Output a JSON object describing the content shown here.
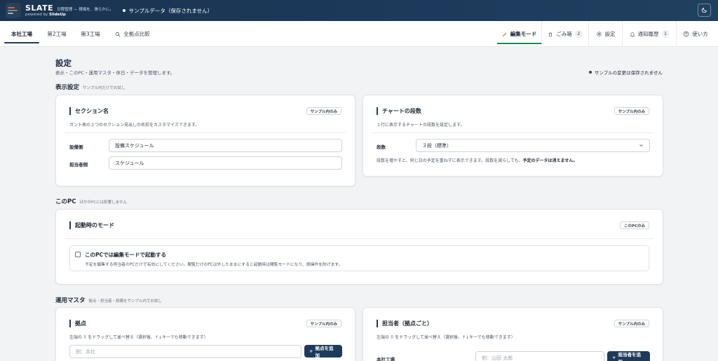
{
  "app": {
    "brand_name": "SLATE",
    "tagline": "日程管理 — 現場を、滑らかに。",
    "powered_prefix": "powered by ",
    "powered_by": "SlideUp",
    "sample_status": "サンプルデータ（保存されません）"
  },
  "nav": {
    "tabs": [
      {
        "label": "本社工場",
        "active": true
      },
      {
        "label": "第2工場"
      },
      {
        "label": "第3工場"
      },
      {
        "label": "全拠点比較",
        "icon": "search-icon"
      }
    ],
    "right": {
      "edit_mode": "編集モード",
      "trash": "ごみ箱",
      "trash_count": "2",
      "settings": "設定",
      "notifications": "通知履歴",
      "notifications_count": "1",
      "help": "使い方"
    }
  },
  "page": {
    "title": "設定",
    "subtitle": "表示・このPC・運用マスタ・休日・データを管理します。",
    "unsaved_note": "サンプルの変更は保存されません"
  },
  "sections": {
    "display": {
      "title": "表示設定",
      "note": "サンプル内だけでお試し"
    },
    "this_pc": {
      "title": "このPC",
      "note": "ほかのPCには影響しません"
    },
    "master": {
      "title": "運用マスタ",
      "note": "拠点・担当者・設備をサンプル内でお試し"
    }
  },
  "cards": {
    "section_name": {
      "title": "セクション名",
      "pill": "サンプル内のみ",
      "desc": "ガント表の２つのセクション見出しの名前をカスタマイズできます。",
      "equipment_label": "設備側",
      "equipment_value": "設備スケジュール",
      "person_label": "担当者側",
      "person_value": "スケジュール"
    },
    "chart_rows": {
      "title": "チャートの段数",
      "pill": "サンプル内のみ",
      "desc": "１行に表示するチャートの段数を設定します。",
      "rows_label": "段数",
      "rows_value": "３段（標準）",
      "note_main": "段数を増やすと、同じ日の予定を重ねずに表示できます。段数を減らしても、",
      "note_bold": "予定のデータは消えません。"
    },
    "startup_mode": {
      "title": "起動時のモード",
      "pill": "このPCのみ",
      "check_label": "このPCでは編集モードで起動する",
      "check_desc": "予定を編集する担当者のPCだけで有効にしてください。閲覧だけのPCは外したままにすると起動時は閲覧モードになり、誤操作を防げます。",
      "checked": false
    },
    "sites": {
      "title": "拠点",
      "pill": "サンプル内のみ",
      "desc": "左端の ⠿ をドラッグして並べ替え（選択後、↑↓キーでも移動できます）",
      "placeholder": "例：本社",
      "add_label": "拠点を追加"
    },
    "staff": {
      "title": "担当者（拠点ごと）",
      "pill": "サンプル内のみ",
      "desc": "左端の ⠿ をドラッグして並べ替え（選択後、↑↓キーでも移動できます）",
      "site_label": "本社工場",
      "placeholder": "例：山田 太郎",
      "add_label": "担当者を追加"
    }
  },
  "colors": {
    "navy": "#1d3a5c",
    "accent_green": "#1f8a4c",
    "logo_orange": "#e35d3a"
  }
}
